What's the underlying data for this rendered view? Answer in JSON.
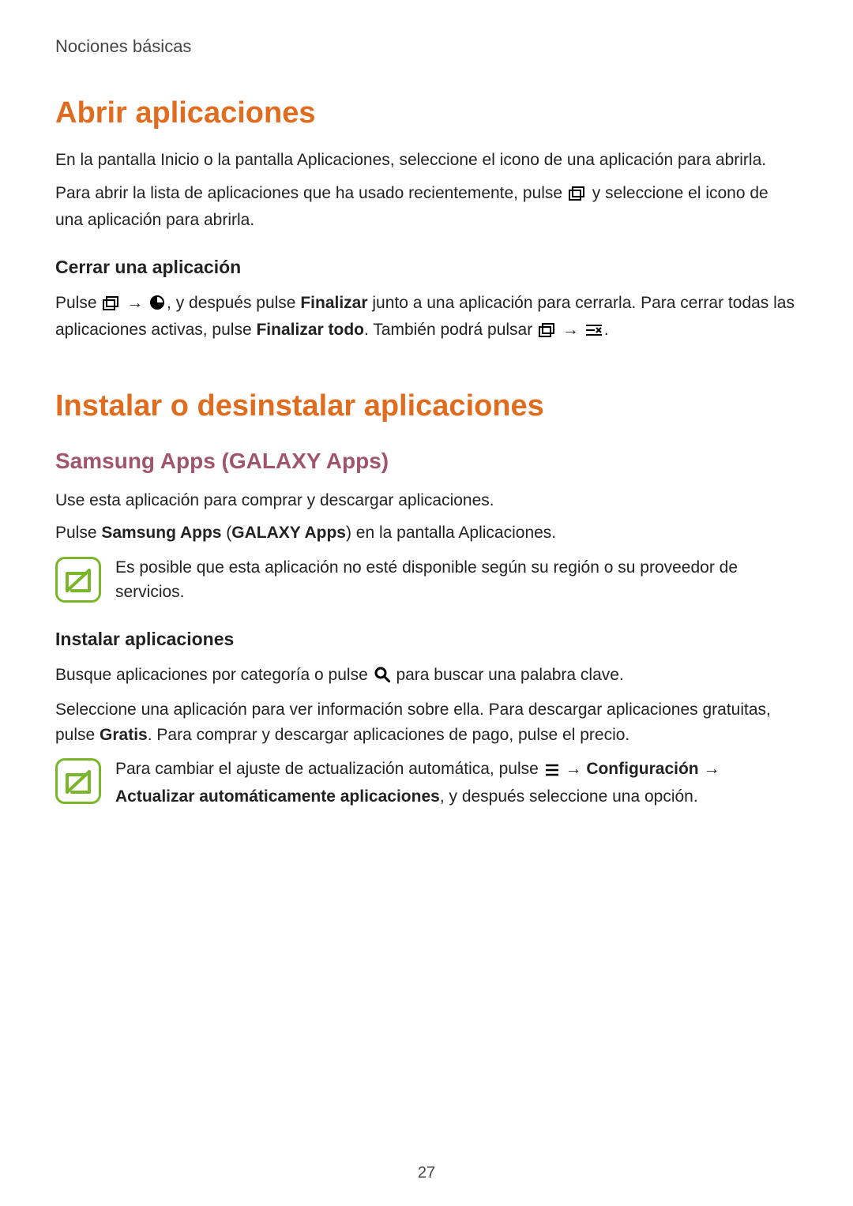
{
  "header": {
    "breadcrumb": "Nociones básicas"
  },
  "s1": {
    "title": "Abrir aplicaciones",
    "p1a": "En la pantalla Inicio o la pantalla Aplicaciones, seleccione el icono de una aplicación para abrirla.",
    "p2a": "Para abrir la lista de aplicaciones que ha usado recientemente, pulse ",
    "p2b": " y seleccione el icono de una aplicación para abrirla.",
    "sub1": {
      "title": "Cerrar una aplicación",
      "p1a": "Pulse ",
      "p1b": " → ",
      "p1c": ", y después pulse ",
      "p1d": "Finalizar",
      "p1e": " junto a una aplicación para cerrarla. Para cerrar todas las aplicaciones activas, pulse ",
      "p1f": "Finalizar todo",
      "p1g": ". También podrá pulsar ",
      "p1h": " → ",
      "p1i": "."
    }
  },
  "s2": {
    "title": "Instalar o desinstalar aplicaciones",
    "sub1": {
      "title": "Samsung Apps (GALAXY Apps)",
      "p1": "Use esta aplicación para comprar y descargar aplicaciones.",
      "p2a": "Pulse ",
      "p2b": "Samsung Apps",
      "p2c": " (",
      "p2d": "GALAXY Apps",
      "p2e": ") en la pantalla Aplicaciones.",
      "note1": "Es posible que esta aplicación no esté disponible según su región o su proveedor de servicios."
    },
    "sub2": {
      "title": "Instalar aplicaciones",
      "p1a": "Busque aplicaciones por categoría o pulse ",
      "p1b": " para buscar una palabra clave.",
      "p2a": "Seleccione una aplicación para ver información sobre ella. Para descargar aplicaciones gratuitas, pulse ",
      "p2b": "Gratis",
      "p2c": ". Para comprar y descargar aplicaciones de pago, pulse el precio.",
      "note2a": "Para cambiar el ajuste de actualización automática, pulse ",
      "note2b": " → ",
      "note2c": "Configuración",
      "note2d": " → ",
      "note2e": "Actualizar automáticamente aplicaciones",
      "note2f": ", y después seleccione una opción."
    }
  },
  "pageNumber": "27"
}
